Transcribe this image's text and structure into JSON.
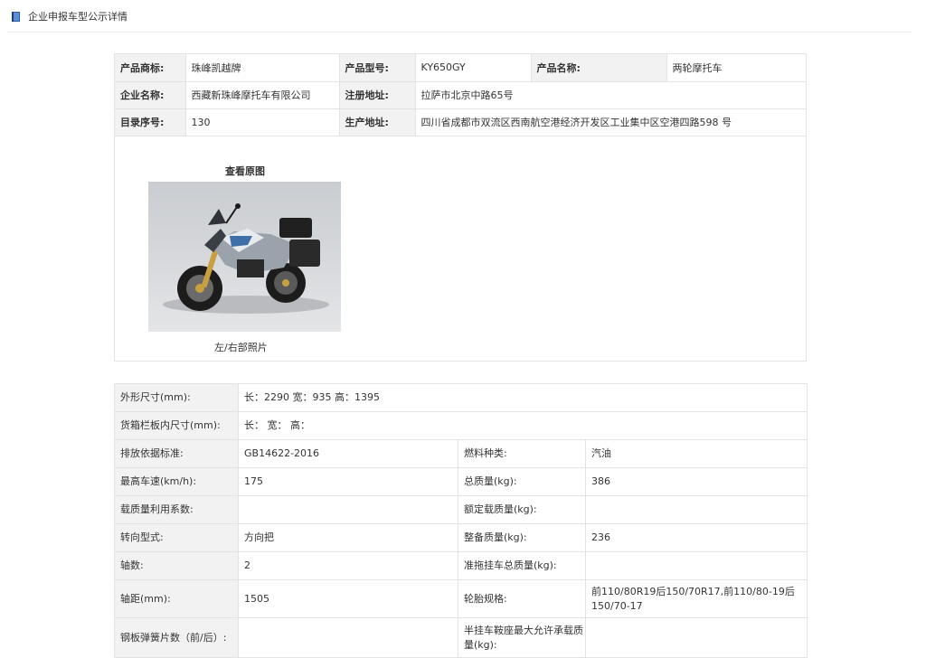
{
  "header": {
    "title": "企业申报车型公示详情",
    "icon": "book-icon",
    "icon_color": "#2b5ba8"
  },
  "basic": {
    "brand_label": "产品商标:",
    "brand_value": "珠峰凯越牌",
    "model_label": "产品型号:",
    "model_value": "KY650GY",
    "name_label": "产品名称:",
    "name_value": "两轮摩托车",
    "company_label": "企业名称:",
    "company_value": "西藏新珠峰摩托车有限公司",
    "reg_addr_label": "注册地址:",
    "reg_addr_value": "拉萨市北京中路65号",
    "catalog_label": "目录序号:",
    "catalog_value": "130",
    "prod_addr_label": "生产地址:",
    "prod_addr_value": "四川省成都市双流区西南航空港经济开发区工业集中区空港四路598 号"
  },
  "photo": {
    "title": "查看原图",
    "caption": "左/右部照片"
  },
  "specs": {
    "dims_label": "外形尺寸(mm):",
    "dims_value": "长：2290 宽：935 高：1395",
    "cargo_label": "货箱栏板内尺寸(mm):",
    "cargo_value": "长：  宽：  高：",
    "emission_label": "排放依据标准:",
    "emission_value": "GB14622-2016",
    "fuel_label": "燃料种类:",
    "fuel_value": "汽油",
    "speed_label": "最高车速(km/h):",
    "speed_value": "175",
    "total_mass_label": "总质量(kg):",
    "total_mass_value": "386",
    "load_coef_label": "载质量利用系数:",
    "load_coef_value": "",
    "rated_load_label": "额定载质量(kg):",
    "rated_load_value": "",
    "steering_label": "转向型式:",
    "steering_value": "方向把",
    "curb_label": "整备质量(kg):",
    "curb_value": "236",
    "axles_label": "轴数:",
    "axles_value": "2",
    "trailer_label": "准拖挂车总质量(kg):",
    "trailer_value": "",
    "wheelbase_label": "轴距(mm):",
    "wheelbase_value": "1505",
    "tire_label": "轮胎规格:",
    "tire_value": "前110/80R19后150/70R17,前110/80-19后150/70-17",
    "spring_label": "钢板弹簧片数（前/后）:",
    "spring_value": "",
    "saddle_label": "半挂车鞍座最大允许承载质量(kg):",
    "saddle_value": ""
  }
}
